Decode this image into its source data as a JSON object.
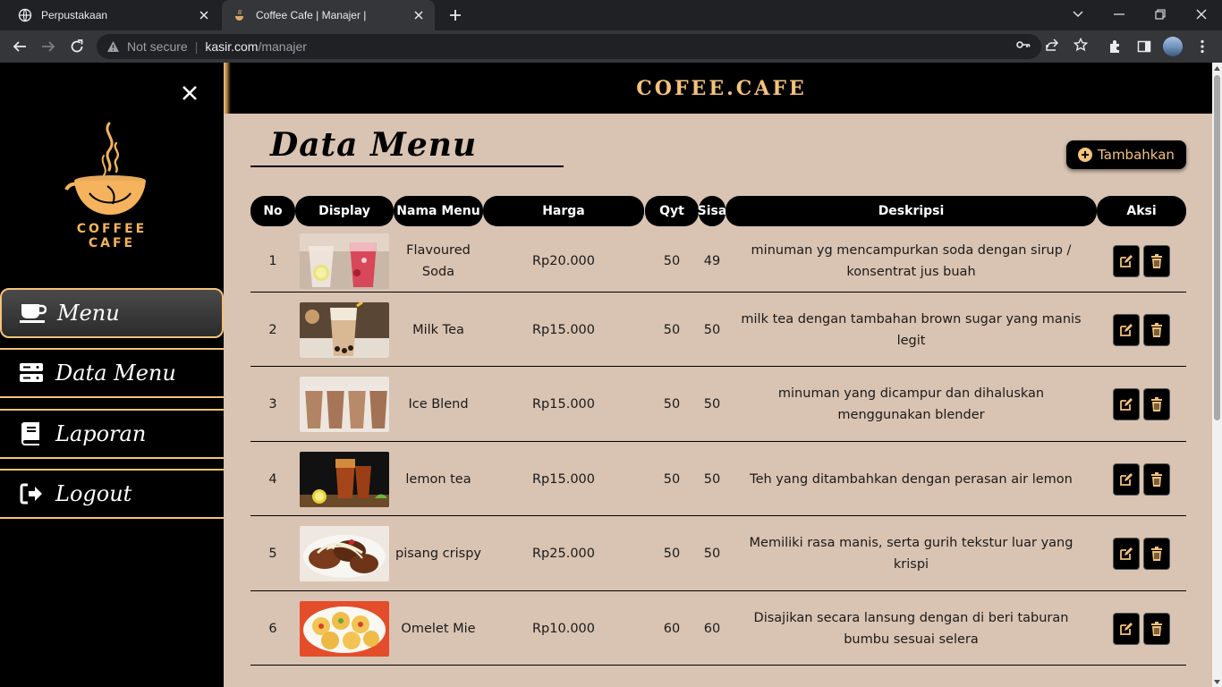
{
  "browser": {
    "tabs": [
      {
        "title": "Perpustakaan",
        "active": false
      },
      {
        "title": "Coffee Cafe | Manajer |",
        "active": true
      }
    ],
    "address": {
      "security": "Not secure",
      "host": "kasir.com",
      "path": "/manajer"
    }
  },
  "brand": "COFEE.CAFE",
  "logo_text": "COFFEE CAFE",
  "sidebar": {
    "items": [
      {
        "label": "Menu",
        "icon": "mug-icon",
        "active": true
      },
      {
        "label": "Data Menu",
        "icon": "server-icon",
        "active": false
      },
      {
        "label": "Laporan",
        "icon": "book-icon",
        "active": false
      },
      {
        "label": "Logout",
        "icon": "logout-icon",
        "active": false
      }
    ]
  },
  "main": {
    "title": "Data Menu",
    "add_label": "Tambahkan",
    "columns": [
      "No",
      "Display",
      "Nama Menu",
      "Harga",
      "Qyt",
      "Sisa",
      "Deskripsi",
      "Aksi"
    ],
    "rows": [
      {
        "no": "1",
        "name": "Flavoured Soda",
        "price": "Rp20.000",
        "qty": "50",
        "sisa": "49",
        "desc": "minuman yg mencampurkan soda dengan sirup / konsentrat jus buah",
        "img": "soda"
      },
      {
        "no": "2",
        "name": "Milk Tea",
        "price": "Rp15.000",
        "qty": "50",
        "sisa": "50",
        "desc": "milk tea dengan tambahan brown sugar yang manis legit",
        "img": "milktea"
      },
      {
        "no": "3",
        "name": "Ice Blend",
        "price": "Rp15.000",
        "qty": "50",
        "sisa": "50",
        "desc": "minuman yang dicampur dan dihaluskan menggunakan blender",
        "img": "iceblend"
      },
      {
        "no": "4",
        "name": "lemon tea",
        "price": "Rp15.000",
        "qty": "50",
        "sisa": "50",
        "desc": "Teh yang ditambahkan dengan perasan air lemon",
        "img": "lemontea"
      },
      {
        "no": "5",
        "name": "pisang crispy",
        "price": "Rp25.000",
        "qty": "50",
        "sisa": "50",
        "desc": "Memiliki rasa manis, serta gurih tekstur luar yang krispi",
        "img": "pisang"
      },
      {
        "no": "6",
        "name": "Omelet Mie",
        "price": "Rp10.000",
        "qty": "60",
        "sisa": "60",
        "desc": "Disajikan secara lansung dengan di beri taburan bumbu sesuai selera",
        "img": "omelet"
      }
    ]
  },
  "colors": {
    "accent": "#f4c27a",
    "content_bg": "#d9c3b2",
    "sidebar_bg": "#000000"
  }
}
